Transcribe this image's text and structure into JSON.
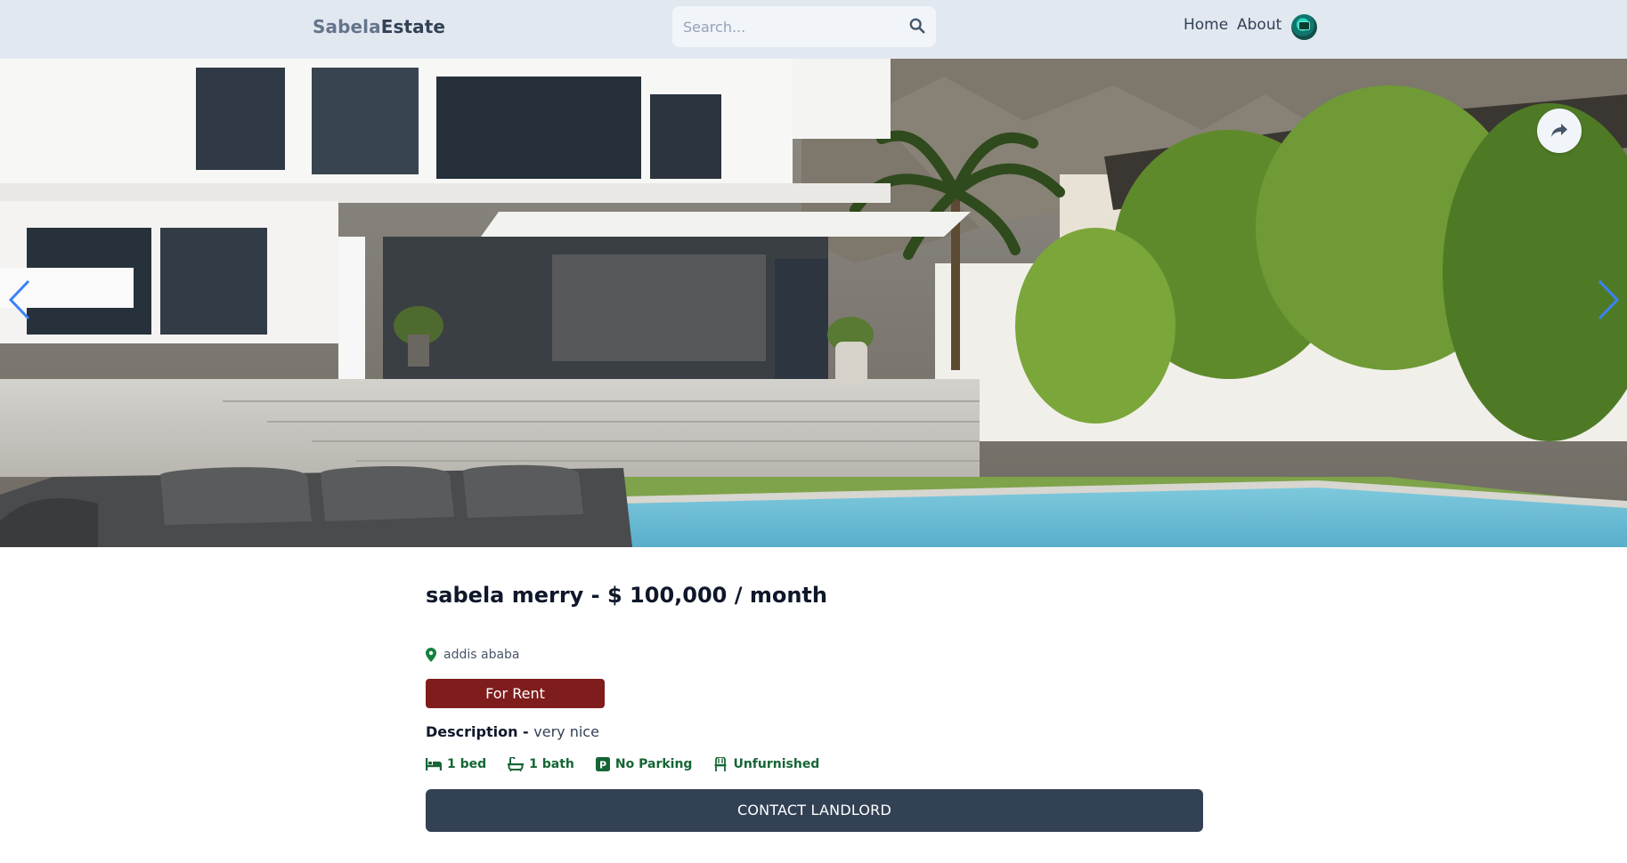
{
  "header": {
    "logo_part1": "Sabela",
    "logo_part2": "Estate",
    "search": {
      "placeholder": "Search...",
      "value": ""
    },
    "nav": {
      "home": "Home",
      "about": "About"
    }
  },
  "listing": {
    "title": "sabela merry - $ 100,000 / month",
    "location": "addis ababa",
    "type_badge": "For Rent",
    "description_label": "Description - ",
    "description": "very nice",
    "features": {
      "beds": "1 bed",
      "baths": "1 bath",
      "parking": "No Parking",
      "furnished": "Unfurnished"
    },
    "contact_button": "CONTACT LANDLORD"
  },
  "icons": {
    "search": "search-icon",
    "share": "share-icon",
    "location": "map-pin-icon",
    "bed": "bed-icon",
    "bath": "bath-icon",
    "parking": "parking-icon",
    "furnished": "chair-icon",
    "prev": "chevron-left-icon",
    "next": "chevron-right-icon"
  },
  "colors": {
    "header_bg": "#e2e8f0",
    "badge_bg": "#7f1d1d",
    "feature_text": "#166534",
    "button_bg": "#334155",
    "carousel_arrow": "#3b82f6"
  }
}
